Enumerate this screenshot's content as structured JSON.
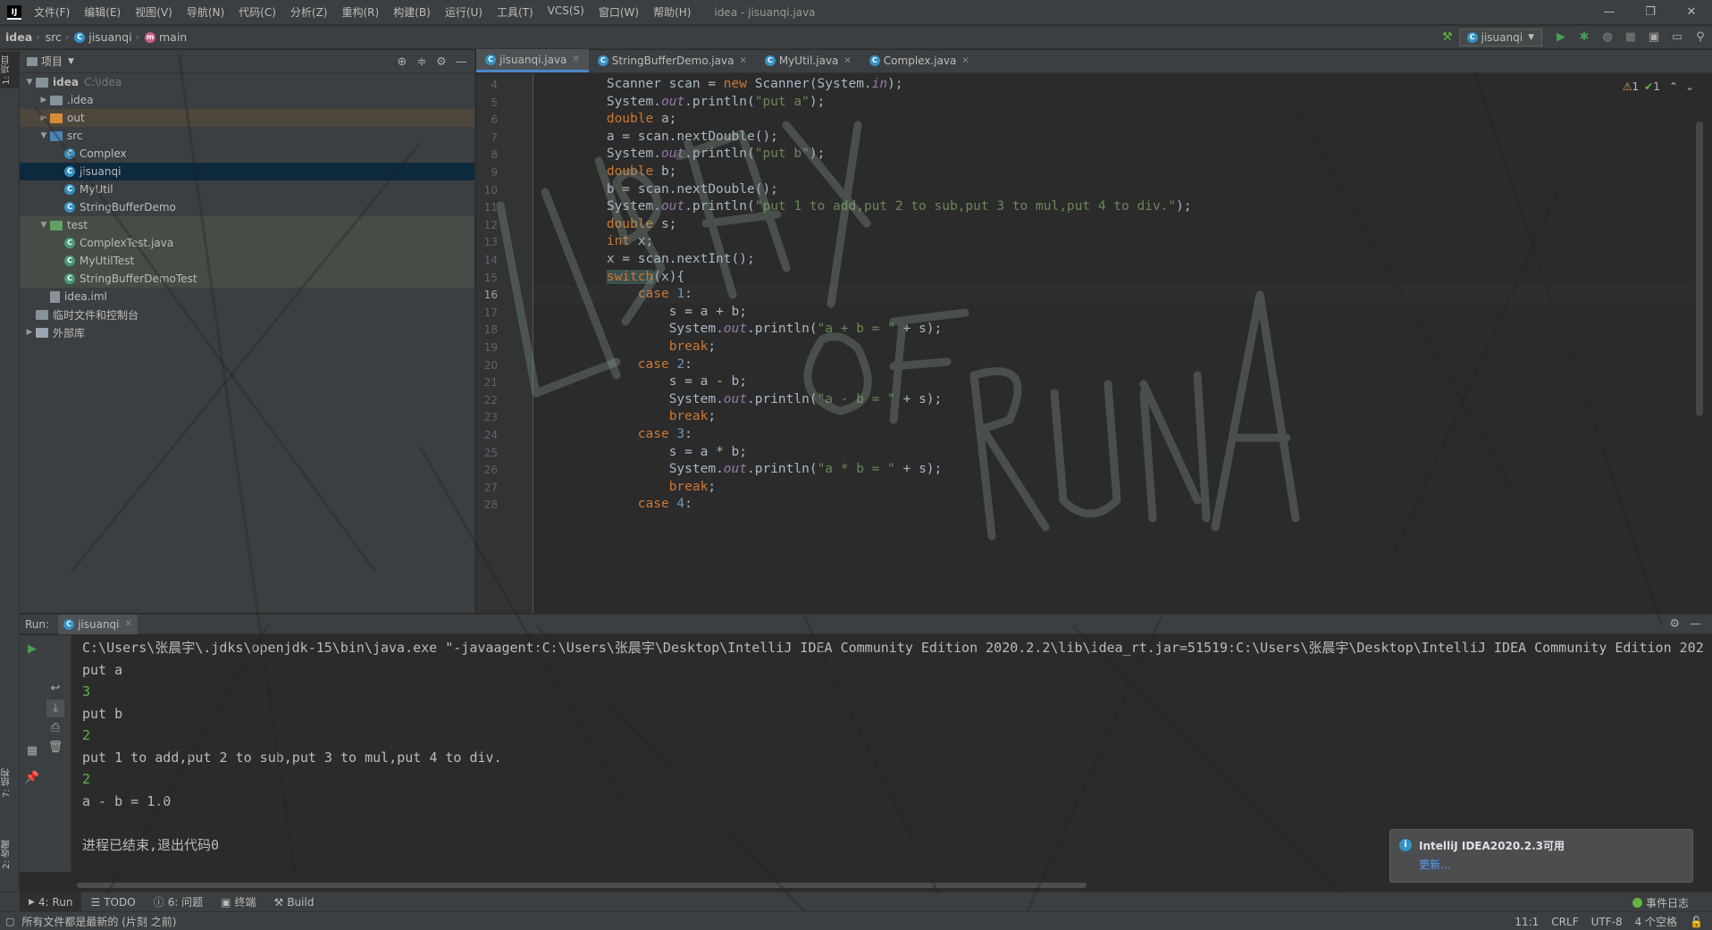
{
  "app": {
    "logo": "IJ",
    "window_title": "idea - jisuanqi.java",
    "menu": [
      "文件(F)",
      "编辑(E)",
      "视图(V)",
      "导航(N)",
      "代码(C)",
      "分析(Z)",
      "重构(R)",
      "构建(B)",
      "运行(U)",
      "工具(T)",
      "VCS(S)",
      "窗口(W)",
      "帮助(H)"
    ],
    "window_controls": [
      "—",
      "❐",
      "✕"
    ]
  },
  "navbar": {
    "crumbs": [
      "idea",
      "src",
      "jisuanqi",
      "main"
    ],
    "run_config": "jisuanqi"
  },
  "left_strip": {
    "project_tab": "1: 项目",
    "structure_tab": "7: 结构",
    "favorites_tab": "2: 收藏"
  },
  "project": {
    "title": "项目",
    "tree": [
      {
        "label": "idea",
        "extra": "C:\\idea",
        "level": 0,
        "kind": "folder",
        "expanded": true
      },
      {
        "label": ".idea",
        "level": 1,
        "kind": "folder",
        "expanded": false
      },
      {
        "label": "out",
        "level": 1,
        "kind": "folder-orange",
        "expanded": false
      },
      {
        "label": "src",
        "level": 1,
        "kind": "folder-blue",
        "expanded": true
      },
      {
        "label": "Complex",
        "level": 2,
        "kind": "class"
      },
      {
        "label": "jisuanqi",
        "level": 2,
        "kind": "class",
        "selected": true
      },
      {
        "label": "MyUtil",
        "level": 2,
        "kind": "class"
      },
      {
        "label": "StringBufferDemo",
        "level": 2,
        "kind": "class"
      },
      {
        "label": "test",
        "level": 1,
        "kind": "folder-green",
        "expanded": true
      },
      {
        "label": "ComplexTest.java",
        "level": 2,
        "kind": "test"
      },
      {
        "label": "MyUtilTest",
        "level": 2,
        "kind": "test"
      },
      {
        "label": "StringBufferDemoTest",
        "level": 2,
        "kind": "test"
      },
      {
        "label": "idea.iml",
        "level": 1,
        "kind": "file"
      },
      {
        "label": "临时文件和控制台",
        "level": 0,
        "kind": "scratch"
      },
      {
        "label": "外部库",
        "level": 0,
        "kind": "lib",
        "expanded": false
      }
    ]
  },
  "editor": {
    "tabs": [
      {
        "label": "jisuanqi.java",
        "active": true
      },
      {
        "label": "StringBufferDemo.java",
        "active": false
      },
      {
        "label": "MyUtil.java",
        "active": false
      },
      {
        "label": "Complex.java",
        "active": false
      }
    ],
    "inspections": {
      "warnings": "1",
      "weak": "1"
    },
    "current_line": 16,
    "lines": [
      {
        "n": 4,
        "indent": 8,
        "tokens": [
          [
            "Scanner scan = ",
            "p"
          ],
          [
            "new ",
            "kw"
          ],
          [
            "Scanner(System.",
            "p"
          ],
          [
            "in",
            "fld"
          ],
          [
            ");",
            "p"
          ]
        ]
      },
      {
        "n": 5,
        "indent": 8,
        "tokens": [
          [
            "System.",
            "p"
          ],
          [
            "out",
            "fld"
          ],
          [
            ".println(",
            "p"
          ],
          [
            "\"put a\"",
            "str"
          ],
          [
            ");",
            "p"
          ]
        ]
      },
      {
        "n": 6,
        "indent": 8,
        "tokens": [
          [
            "double ",
            "kw"
          ],
          [
            "a;",
            "p"
          ]
        ]
      },
      {
        "n": 7,
        "indent": 8,
        "tokens": [
          [
            "a = scan.nextDouble();",
            "p"
          ]
        ]
      },
      {
        "n": 8,
        "indent": 8,
        "tokens": [
          [
            "System.",
            "p"
          ],
          [
            "out",
            "fld"
          ],
          [
            ".println(",
            "p"
          ],
          [
            "\"put b\"",
            "str"
          ],
          [
            ");",
            "p"
          ]
        ]
      },
      {
        "n": 9,
        "indent": 8,
        "tokens": [
          [
            "double ",
            "kw"
          ],
          [
            "b;",
            "p"
          ]
        ]
      },
      {
        "n": 10,
        "indent": 8,
        "tokens": [
          [
            "b = scan.nextDouble();",
            "p"
          ]
        ]
      },
      {
        "n": 11,
        "indent": 8,
        "tokens": [
          [
            "System.",
            "p"
          ],
          [
            "out",
            "fld"
          ],
          [
            ".println(",
            "p"
          ],
          [
            "\"put 1 to add,put 2 to sub,put 3 to mul,put 4 to div.\"",
            "str"
          ],
          [
            ");",
            "p"
          ]
        ]
      },
      {
        "n": 12,
        "indent": 8,
        "tokens": [
          [
            "double ",
            "kw"
          ],
          [
            "s;",
            "p"
          ]
        ]
      },
      {
        "n": 13,
        "indent": 8,
        "tokens": [
          [
            "int ",
            "kw"
          ],
          [
            "x;",
            "p"
          ]
        ]
      },
      {
        "n": 14,
        "indent": 8,
        "tokens": [
          [
            "x = scan.nextInt();",
            "p"
          ]
        ]
      },
      {
        "n": 15,
        "indent": 8,
        "tokens": [
          [
            "switch",
            "sw"
          ],
          [
            "(x){",
            "p"
          ]
        ]
      },
      {
        "n": 16,
        "indent": 12,
        "tokens": [
          [
            "case ",
            "kw"
          ],
          [
            "1",
            "num"
          ],
          [
            ":",
            "p"
          ]
        ]
      },
      {
        "n": 17,
        "indent": 16,
        "tokens": [
          [
            "s = a + b;",
            "p"
          ]
        ]
      },
      {
        "n": 18,
        "indent": 16,
        "tokens": [
          [
            "System.",
            "p"
          ],
          [
            "out",
            "fld"
          ],
          [
            ".println(",
            "p"
          ],
          [
            "\"a + b = \"",
            "str"
          ],
          [
            " + s);",
            "p"
          ]
        ]
      },
      {
        "n": 19,
        "indent": 16,
        "tokens": [
          [
            "break",
            "kw"
          ],
          [
            ";",
            "p"
          ]
        ]
      },
      {
        "n": 20,
        "indent": 12,
        "tokens": [
          [
            "case ",
            "kw"
          ],
          [
            "2",
            "num"
          ],
          [
            ":",
            "p"
          ]
        ]
      },
      {
        "n": 21,
        "indent": 16,
        "tokens": [
          [
            "s = a - b;",
            "p"
          ]
        ]
      },
      {
        "n": 22,
        "indent": 16,
        "tokens": [
          [
            "System.",
            "p"
          ],
          [
            "out",
            "fld"
          ],
          [
            ".println(",
            "p"
          ],
          [
            "\"a - b = \"",
            "str"
          ],
          [
            " + s);",
            "p"
          ]
        ]
      },
      {
        "n": 23,
        "indent": 16,
        "tokens": [
          [
            "break",
            "kw"
          ],
          [
            ";",
            "p"
          ]
        ]
      },
      {
        "n": 24,
        "indent": 12,
        "tokens": [
          [
            "case ",
            "kw"
          ],
          [
            "3",
            "num"
          ],
          [
            ":",
            "p"
          ]
        ]
      },
      {
        "n": 25,
        "indent": 16,
        "tokens": [
          [
            "s = a * b;",
            "p"
          ]
        ]
      },
      {
        "n": 26,
        "indent": 16,
        "tokens": [
          [
            "System.",
            "p"
          ],
          [
            "out",
            "fld"
          ],
          [
            ".println(",
            "p"
          ],
          [
            "\"a * b = \"",
            "str"
          ],
          [
            " + s);",
            "p"
          ]
        ]
      },
      {
        "n": 27,
        "indent": 16,
        "tokens": [
          [
            "break",
            "kw"
          ],
          [
            ";",
            "p"
          ]
        ]
      },
      {
        "n": 28,
        "indent": 12,
        "tokens": [
          [
            "case ",
            "kw"
          ],
          [
            "4",
            "num"
          ],
          [
            ":",
            "p"
          ]
        ]
      }
    ]
  },
  "run": {
    "label": "Run:",
    "tab": "jisuanqi",
    "console": [
      {
        "text": "C:\\Users\\张晨宇\\.jdks\\openjdk-15\\bin\\java.exe \"-javaagent:C:\\Users\\张晨宇\\Desktop\\IntelliJ IDEA Community Edition 2020.2.2\\lib\\idea_rt.jar=51519:C:\\Users\\张晨宇\\Desktop\\IntelliJ IDEA Community Edition 202",
        "input": false
      },
      {
        "text": "put a",
        "input": false
      },
      {
        "text": "3",
        "input": true
      },
      {
        "text": "put b",
        "input": false
      },
      {
        "text": "2",
        "input": true
      },
      {
        "text": "put 1 to add,put 2 to sub,put 3 to mul,put 4 to div.",
        "input": false
      },
      {
        "text": "2",
        "input": true
      },
      {
        "text": "a - b = 1.0",
        "input": false
      },
      {
        "text": "",
        "input": false
      },
      {
        "text": "进程已结束,退出代码0",
        "input": false
      }
    ]
  },
  "notification": {
    "title": "IntelliJ IDEA2020.2.3可用",
    "link": "更新..."
  },
  "bottom_tabs": [
    {
      "label": "4: Run",
      "active": true
    },
    {
      "label": "TODO",
      "active": false
    },
    {
      "label": "6: 问题",
      "active": false
    },
    {
      "label": "终端",
      "active": false
    },
    {
      "label": "Build",
      "active": false
    }
  ],
  "event_log": "事件日志",
  "status": {
    "message": "所有文件都是最新的 (片刻 之前)",
    "position": "11:1",
    "line_sep": "CRLF",
    "encoding": "UTF-8",
    "indent": "4 个空格"
  },
  "colors": {
    "keyword": "#cc7832",
    "string": "#6a8759",
    "field": "#9876aa",
    "number": "#6897bb",
    "plain": "#a9b7c6",
    "selection": "#0d293e",
    "accent": "#4a88c7"
  }
}
